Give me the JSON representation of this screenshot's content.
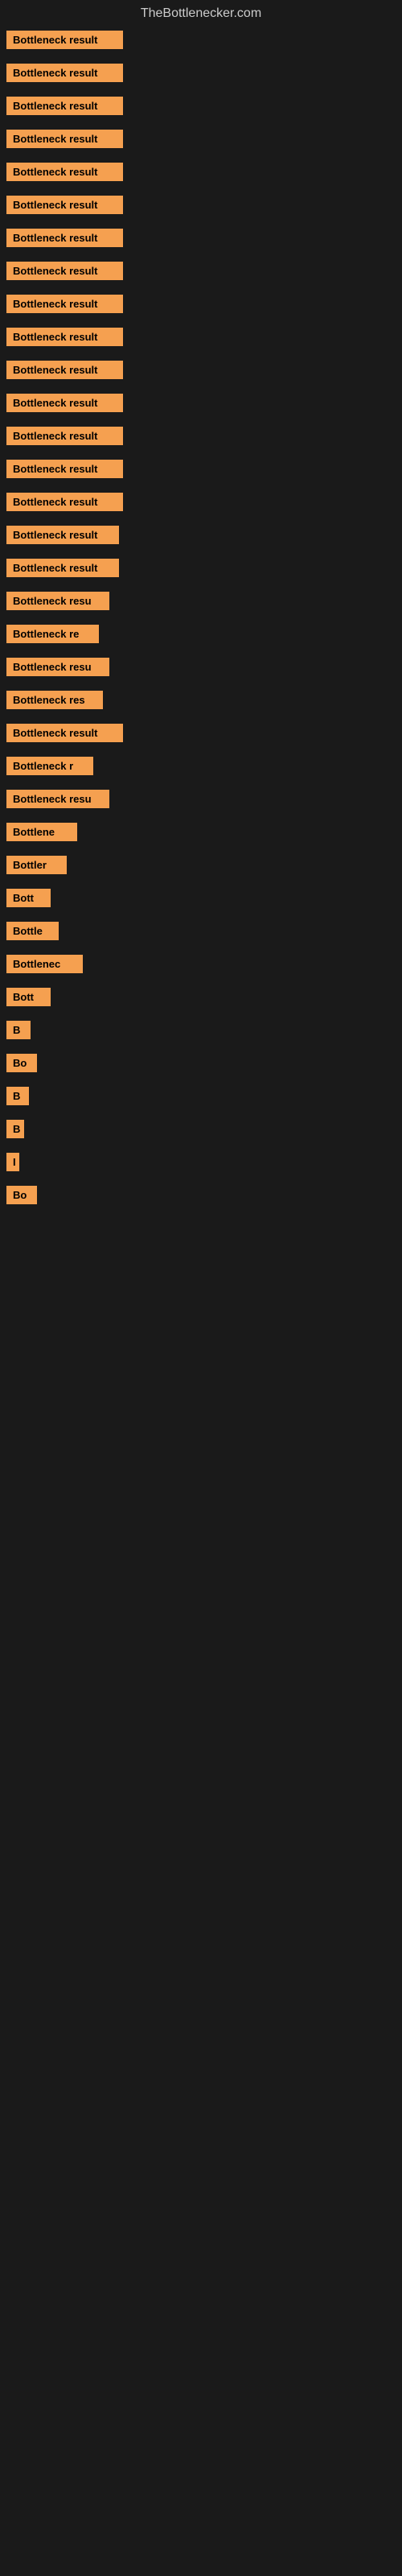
{
  "site": {
    "title": "TheBottlenecker.com"
  },
  "bars": [
    {
      "label": "Bottleneck result",
      "width": 145
    },
    {
      "label": "Bottleneck result",
      "width": 145
    },
    {
      "label": "Bottleneck result",
      "width": 145
    },
    {
      "label": "Bottleneck result",
      "width": 145
    },
    {
      "label": "Bottleneck result",
      "width": 145
    },
    {
      "label": "Bottleneck result",
      "width": 145
    },
    {
      "label": "Bottleneck result",
      "width": 145
    },
    {
      "label": "Bottleneck result",
      "width": 145
    },
    {
      "label": "Bottleneck result",
      "width": 145
    },
    {
      "label": "Bottleneck result",
      "width": 145
    },
    {
      "label": "Bottleneck result",
      "width": 145
    },
    {
      "label": "Bottleneck result",
      "width": 145
    },
    {
      "label": "Bottleneck result",
      "width": 145
    },
    {
      "label": "Bottleneck result",
      "width": 145
    },
    {
      "label": "Bottleneck result",
      "width": 145
    },
    {
      "label": "Bottleneck result",
      "width": 140
    },
    {
      "label": "Bottleneck result",
      "width": 140
    },
    {
      "label": "Bottleneck resu",
      "width": 128
    },
    {
      "label": "Bottleneck re",
      "width": 115
    },
    {
      "label": "Bottleneck resu",
      "width": 128
    },
    {
      "label": "Bottleneck res",
      "width": 120
    },
    {
      "label": "Bottleneck result",
      "width": 145
    },
    {
      "label": "Bottleneck r",
      "width": 108
    },
    {
      "label": "Bottleneck resu",
      "width": 128
    },
    {
      "label": "Bottlene",
      "width": 88
    },
    {
      "label": "Bottler",
      "width": 75
    },
    {
      "label": "Bott",
      "width": 55
    },
    {
      "label": "Bottle",
      "width": 65
    },
    {
      "label": "Bottlenec",
      "width": 95
    },
    {
      "label": "Bott",
      "width": 55
    },
    {
      "label": "B",
      "width": 30
    },
    {
      "label": "Bo",
      "width": 38
    },
    {
      "label": "B",
      "width": 28
    },
    {
      "label": "B",
      "width": 22
    },
    {
      "label": "I",
      "width": 14
    },
    {
      "label": "Bo",
      "width": 38
    }
  ]
}
